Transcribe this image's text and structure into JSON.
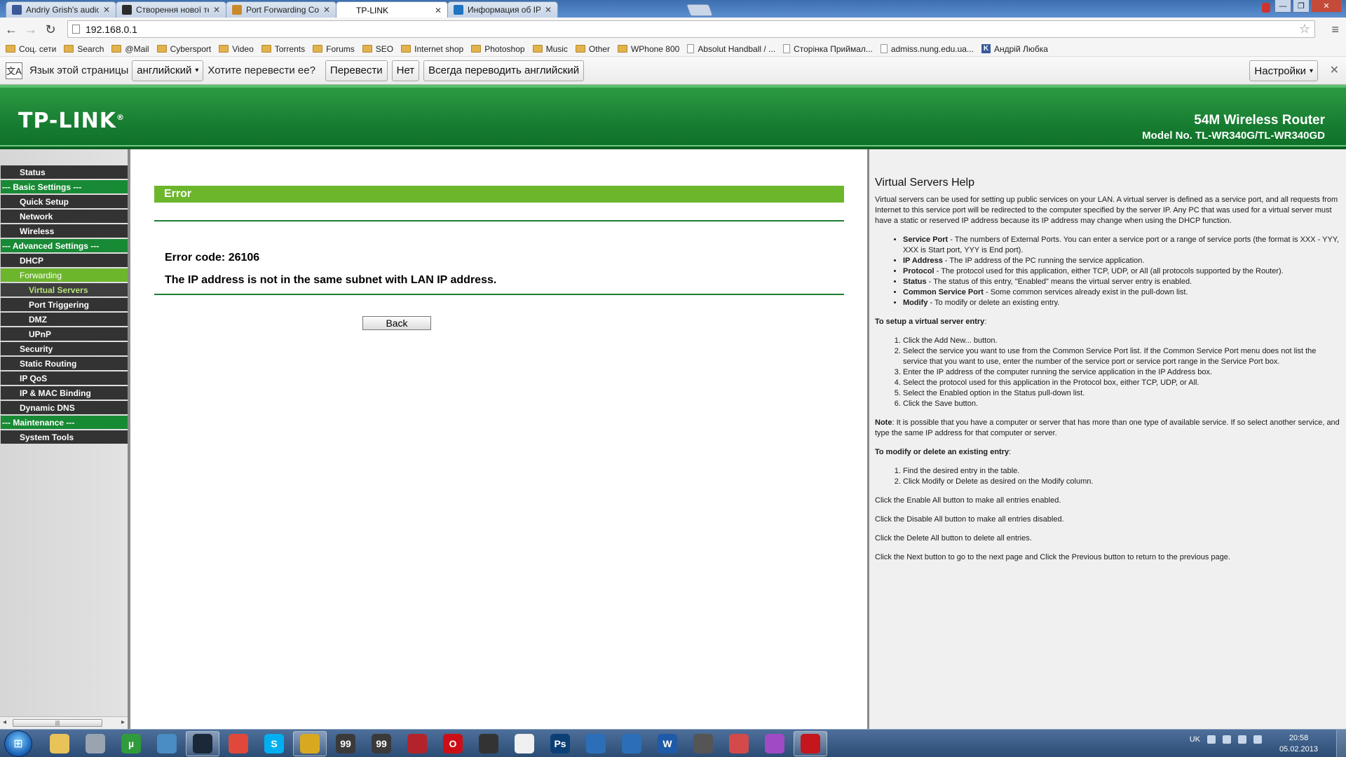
{
  "browser": {
    "tabs": [
      {
        "title": "Andriy Grish's audio files |",
        "favicon_color": "#3b5998",
        "active": false
      },
      {
        "title": "Створення нової теми - (",
        "favicon_color": "#2b2b2b",
        "active": false
      },
      {
        "title": "Port Forwarding Counter",
        "favicon_color": "#c98a2b",
        "active": false
      },
      {
        "title": "TP-LINK",
        "favicon_color": "#ffffff",
        "active": true
      },
      {
        "title": "Информация об IP адрес",
        "favicon_color": "#1f73c0",
        "active": false
      }
    ],
    "url": "192.168.0.1",
    "bookmarks": [
      {
        "label": "Соц. сети",
        "type": "folder"
      },
      {
        "label": "Search",
        "type": "folder"
      },
      {
        "label": "@Mail",
        "type": "folder"
      },
      {
        "label": "Cybersport",
        "type": "folder"
      },
      {
        "label": "Video",
        "type": "folder"
      },
      {
        "label": "Torrents",
        "type": "folder"
      },
      {
        "label": "Forums",
        "type": "folder"
      },
      {
        "label": "SEO",
        "type": "folder"
      },
      {
        "label": "Internet shop",
        "type": "folder"
      },
      {
        "label": "Photoshop",
        "type": "folder"
      },
      {
        "label": "Music",
        "type": "folder"
      },
      {
        "label": "Other",
        "type": "folder"
      },
      {
        "label": "WPhone 800",
        "type": "folder"
      },
      {
        "label": "Absolut Handball / ...",
        "type": "page"
      },
      {
        "label": "Сторінка Приймал...",
        "type": "page"
      },
      {
        "label": "admiss.nung.edu.ua...",
        "type": "page"
      },
      {
        "label": "Андрій Любка",
        "type": "k"
      }
    ]
  },
  "translate": {
    "prompt": "Язык этой страницы",
    "language": "английский",
    "question": "Хотите перевести ее?",
    "translate_btn": "Перевести",
    "no_btn": "Нет",
    "always_btn": "Всегда переводить английский",
    "settings_btn": "Настройки"
  },
  "router": {
    "logo": "TP-LINK",
    "product": "54M Wireless Router",
    "model": "Model No. TL-WR340G/TL-WR340GD",
    "menu": [
      {
        "label": "Status",
        "kind": "item"
      },
      {
        "label": "--- Basic Settings ---",
        "kind": "group"
      },
      {
        "label": "Quick Setup",
        "kind": "item"
      },
      {
        "label": "Network",
        "kind": "item"
      },
      {
        "label": "Wireless",
        "kind": "item"
      },
      {
        "label": "--- Advanced Settings ---",
        "kind": "group"
      },
      {
        "label": "DHCP",
        "kind": "item"
      },
      {
        "label": "Forwarding",
        "kind": "active"
      },
      {
        "label": "Virtual Servers",
        "kind": "subactive"
      },
      {
        "label": "Port Triggering",
        "kind": "sub"
      },
      {
        "label": "DMZ",
        "kind": "sub"
      },
      {
        "label": "UPnP",
        "kind": "sub"
      },
      {
        "label": "Security",
        "kind": "item"
      },
      {
        "label": "Static Routing",
        "kind": "item"
      },
      {
        "label": "IP QoS",
        "kind": "item"
      },
      {
        "label": "IP & MAC Binding",
        "kind": "item"
      },
      {
        "label": "Dynamic DNS",
        "kind": "item"
      },
      {
        "label": "--- Maintenance ---",
        "kind": "group"
      },
      {
        "label": "System Tools",
        "kind": "item"
      }
    ],
    "error": {
      "title": "Error",
      "code": "Error code: 26106",
      "message": "The IP address is not in the same subnet with LAN IP address.",
      "back": "Back"
    }
  },
  "help": {
    "title": "Virtual Servers Help",
    "intro": "Virtual servers can be used for setting up public services on your LAN. A virtual server is defined as a service port, and all requests from Internet to this service port will be redirected to the computer specified by the server IP. Any PC that was used for a virtual server must have a static or reserved IP address because its IP address may change when using the DHCP function.",
    "fields": [
      {
        "name": "Service Port",
        "text": " - The numbers of External Ports. You can enter a service port or a range of service ports (the format is XXX - YYY, XXX is Start port, YYY is End port)."
      },
      {
        "name": "IP Address",
        "text": " - The IP address of the PC running the service application."
      },
      {
        "name": "Protocol",
        "text": " - The protocol used for this application, either TCP, UDP, or All (all protocols supported by the Router)."
      },
      {
        "name": "Status",
        "text": " - The status of this entry, \"Enabled\" means the virtual server entry is enabled."
      },
      {
        "name": "Common Service Port",
        "text": " - Some common services already exist in the pull-down list."
      },
      {
        "name": "Modify",
        "text": " - To modify or delete an existing entry."
      }
    ],
    "setup_title": "To setup a virtual server entry",
    "setup_steps": [
      "Click the Add New... button.",
      "Select the service you want to use from the Common Service Port list. If the Common Service Port menu does not list the service that you want to use, enter the number of the service port or service port range in the Service Port box.",
      "Enter the IP address of the computer running the service application in the IP Address box.",
      "Select the protocol used for this application in the Protocol box, either TCP, UDP, or All.",
      "Select the Enabled option in the Status pull-down list.",
      "Click the Save button."
    ],
    "note_label": "Note",
    "note": ": It is possible that you have a computer or server that has more than one type of available service. If so select another service, and type the same IP address for that computer or server.",
    "modify_title": "To modify or delete an existing entry",
    "modify_steps": [
      "Find the desired entry in the table.",
      "Click Modify or Delete as desired on the Modify column."
    ],
    "enable_all": "Click the Enable All button to make all entries enabled.",
    "disable_all": "Click the Disable All button to make all entries disabled.",
    "delete_all": "Click the Delete All button to delete all entries.",
    "next_prev": "Click the Next button to go to the next page and Click the Previous button to return to the previous page."
  },
  "taskbar": {
    "apps": [
      {
        "name": "explorer-icon",
        "color": "#e7c35a",
        "label": ""
      },
      {
        "name": "media-player-icon",
        "color": "#9aa4b1",
        "label": ""
      },
      {
        "name": "utorrent-icon",
        "color": "#2f9b3b",
        "label": "µ"
      },
      {
        "name": "audio-app-icon",
        "color": "#4a8cc4",
        "label": ""
      },
      {
        "name": "steam-icon",
        "color": "#1b2838",
        "label": ""
      },
      {
        "name": "chrome-icon",
        "color": "#e0483b",
        "label": ""
      },
      {
        "name": "skype-icon",
        "color": "#00aff0",
        "label": "S"
      },
      {
        "name": "game-app-icon",
        "color": "#d8a920",
        "label": ""
      },
      {
        "name": "app-99-icon",
        "color": "#3a3a3a",
        "label": "99"
      },
      {
        "name": "app-99-second-icon",
        "color": "#3a3a3a",
        "label": "99"
      },
      {
        "name": "red-circle-app-icon",
        "color": "#b4232b",
        "label": ""
      },
      {
        "name": "opera-icon",
        "color": "#cc0f16",
        "label": "O"
      },
      {
        "name": "terminal-icon",
        "color": "#333333",
        "label": ""
      },
      {
        "name": "cow-app-icon",
        "color": "#f0f0f0",
        "label": ""
      },
      {
        "name": "photoshop-icon",
        "color": "#0c3f75",
        "label": "Ps"
      },
      {
        "name": "crescent-app-icon",
        "color": "#2c6fb8",
        "label": ""
      },
      {
        "name": "bolt-app-icon",
        "color": "#2c6fb8",
        "label": ""
      },
      {
        "name": "word-icon",
        "color": "#1e5aa8",
        "label": "W"
      },
      {
        "name": "eye-app-icon",
        "color": "#555555",
        "label": ""
      },
      {
        "name": "star-app-icon",
        "color": "#d44a4a",
        "label": ""
      },
      {
        "name": "image-app-icon",
        "color": "#a04ac6",
        "label": ""
      },
      {
        "name": "acrobat-icon",
        "color": "#c4161c",
        "label": ""
      }
    ],
    "lang": "UK",
    "time": "20:58",
    "date": "05.02.2013"
  }
}
